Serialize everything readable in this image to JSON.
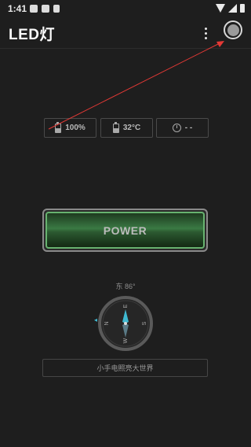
{
  "status_bar": {
    "time": "1:41",
    "icons": [
      "image-icon",
      "notification-icon",
      "a-icon",
      "wifi-icon",
      "signal-icon",
      "battery-icon"
    ]
  },
  "app_bar": {
    "title": "LED灯",
    "menu_icon": "more-vert-icon",
    "record_icon": "record-icon"
  },
  "info": {
    "battery": "100%",
    "temperature": "32°C",
    "timer": "- -"
  },
  "power": {
    "label": "POWER"
  },
  "compass": {
    "heading": "东 86°",
    "labels": {
      "north": "N",
      "east": "E",
      "south": "S",
      "west": "W"
    },
    "needle_color": "#3fb9d1"
  },
  "message": "小手电照亮大世界",
  "colors": {
    "background": "#1e1e1e",
    "power_green": "#3a7a44",
    "power_border": "#67b26f",
    "annotation_arrow": "#e53935"
  }
}
